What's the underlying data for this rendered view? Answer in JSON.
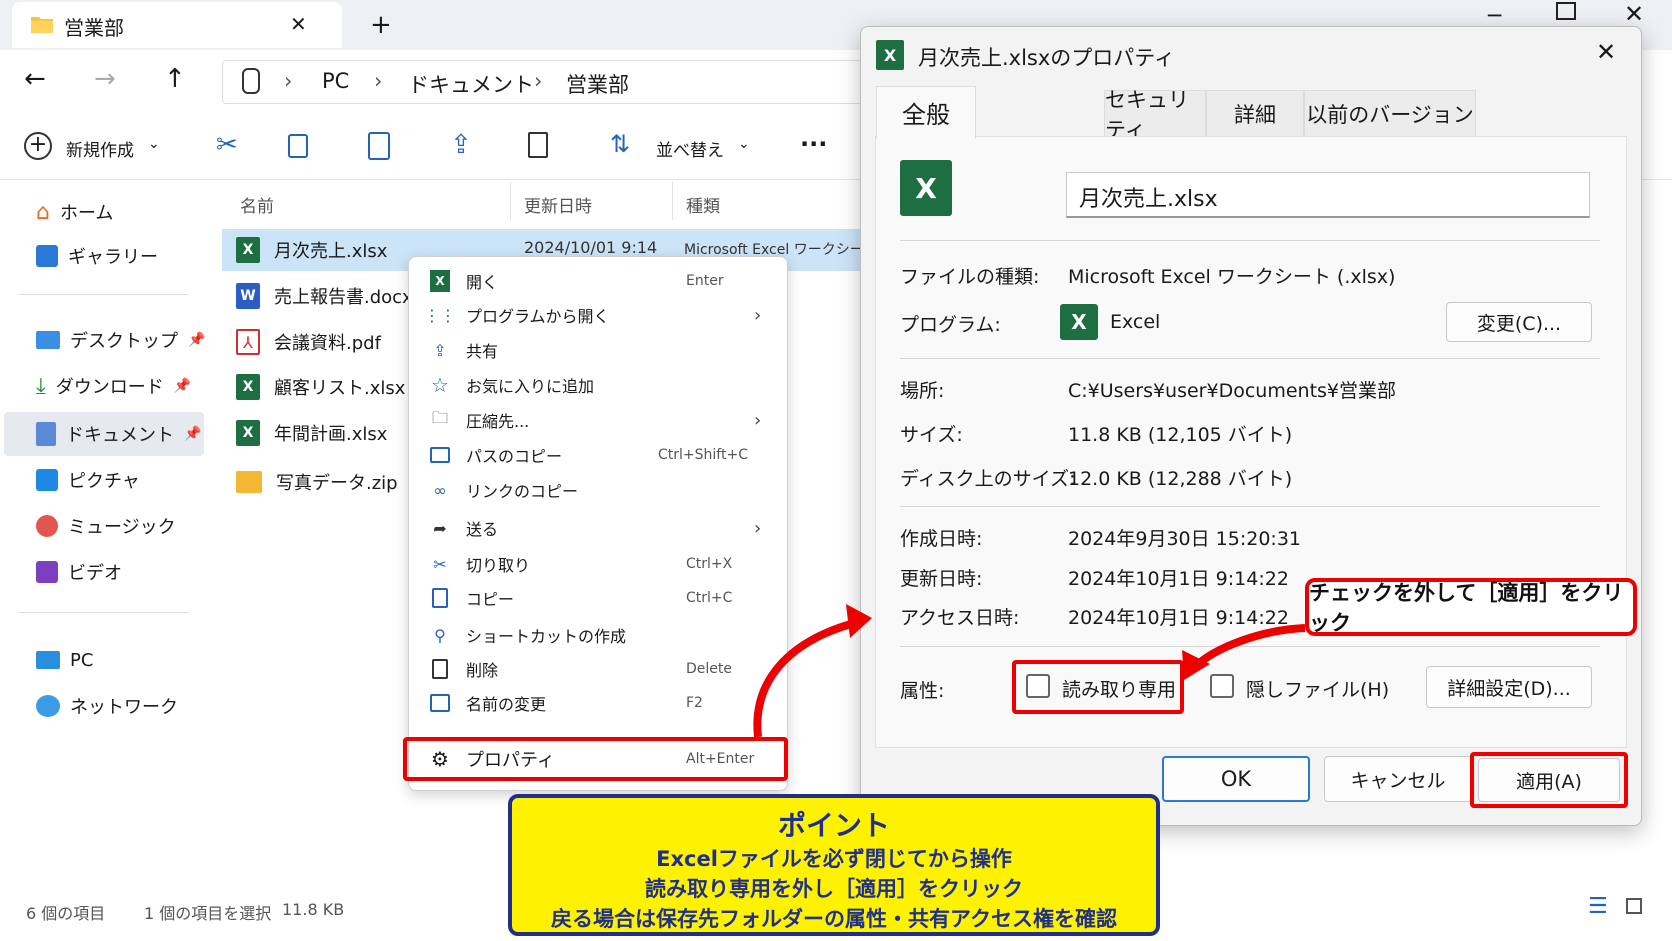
{
  "explorer": {
    "tab_title": "営業部",
    "breadcrumb": [
      "PC",
      "ドキュメント",
      "営業部"
    ],
    "toolbar": {
      "new_label": "新規作成",
      "sort_label": "並べ替え",
      "more": "..."
    },
    "sidebar": {
      "home": "ホーム",
      "gallery": "ギャラリー",
      "desktop": "デスクトップ",
      "downloads": "ダウンロード",
      "documents": "ドキュメント",
      "pictures": "ピクチャ",
      "music": "ミュージック",
      "videos": "ビデオ",
      "pc": "PC",
      "network": "ネットワーク"
    },
    "columns": {
      "name": "名前",
      "modified": "更新日時",
      "type": "種類"
    },
    "files": [
      {
        "name": "月次売上.xlsx",
        "modified": "2024/10/01  9:14",
        "type": "Microsoft Excel ワークシート",
        "icon": "excel-icon"
      },
      {
        "name": "売上報告書.docx",
        "icon": "word-icon"
      },
      {
        "name": "会議資料.pdf",
        "icon": "pdf-icon"
      },
      {
        "name": "顧客リスト.xlsx",
        "icon": "excel-icon"
      },
      {
        "name": "年間計画.xlsx",
        "icon": "excel-icon"
      },
      {
        "name": "写真データ.zip",
        "icon": "zip-folder-icon"
      }
    ],
    "status": {
      "count": "6 個の項目",
      "selected": "1 個の項目を選択",
      "size": "11.8 KB"
    }
  },
  "context_menu": {
    "open": {
      "label": "開く",
      "shortcut": "Enter"
    },
    "open_with": {
      "label": "プログラムから開く"
    },
    "share": {
      "label": "共有"
    },
    "favorite": {
      "label": "お気に入りに追加"
    },
    "compress": {
      "label": "圧縮先..."
    },
    "copy_path": {
      "label": "パスのコピー",
      "shortcut": "Ctrl+Shift+C"
    },
    "copy_link": {
      "label": "リンクのコピー"
    },
    "send_to": {
      "label": "送る"
    },
    "cut": {
      "label": "切り取り",
      "shortcut": "Ctrl+X"
    },
    "copy": {
      "label": "コピー",
      "shortcut": "Ctrl+C"
    },
    "shortcut": {
      "label": "ショートカットの作成"
    },
    "delete": {
      "label": "削除",
      "shortcut": "Delete"
    },
    "rename": {
      "label": "名前の変更",
      "shortcut": "F2"
    },
    "properties": {
      "label": "プロパティ",
      "shortcut": "Alt+Enter"
    }
  },
  "dialog": {
    "title": "月次売上.xlsxのプロパティ",
    "tabs": [
      "全般",
      "セキュリティ",
      "詳細",
      "以前のバージョン"
    ],
    "filename": "月次売上.xlsx",
    "fields": {
      "file_type_label": "ファイルの種類:",
      "file_type": "Microsoft Excel ワークシート (.xlsx)",
      "program_label": "プログラム:",
      "program": "Excel",
      "change_button": "変更(C)...",
      "location_label": "場所:",
      "location": "C:¥Users¥user¥Documents¥営業部",
      "size_label": "サイズ:",
      "size": "11.8 KB (12,105 バイト)",
      "disk_size_label": "ディスク上のサイズ:",
      "disk_size": "12.0 KB (12,288 バイト)",
      "created_label": "作成日時:",
      "created": "2024年9月30日  15:20:31",
      "modified_label": "更新日時:",
      "modified": "2024年10月1日  9:14:22",
      "accessed_label": "アクセス日時:",
      "accessed": "2024年10月1日  9:14:22",
      "attributes_label": "属性:",
      "readonly": "読み取り専用",
      "hidden": "隠しファイル(H)",
      "advanced_button": "詳細設定(D)..."
    },
    "buttons": {
      "ok": "OK",
      "cancel": "キャンセル",
      "apply": "適用(A)"
    }
  },
  "annotations": {
    "callout": "チェックを外して［適用］をクリック",
    "point_title": "ポイント",
    "point_lines": [
      "Excelファイルを必ず閉じてから操作",
      "読み取り専用を外し［適用］をクリック",
      "戻る場合は保存先フォルダーの属性・共有アクセス権を確認"
    ]
  },
  "colors": {
    "highlight_red": "#e00000",
    "point_yellow": "#fff200",
    "point_navy": "#1f2f8a",
    "excel_green": "#1d6f42",
    "selection_blue": "#cce4f7"
  }
}
